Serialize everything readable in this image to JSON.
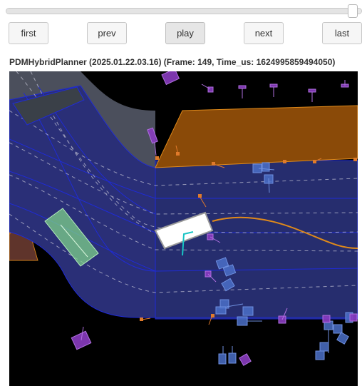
{
  "slider": {
    "position_fraction": 0.99
  },
  "controls": {
    "first_label": "first",
    "prev_label": "prev",
    "play_label": "play",
    "next_label": "next",
    "last_label": "last"
  },
  "header": {
    "title": "PDMHybridPlanner (2025.01.22.03.16) (Frame: 149, Time_us: 1624995859494050)"
  },
  "map": {
    "colors": {
      "background": "#000000",
      "lane": "#2a2f77",
      "lane_edge": "#1f2bd6",
      "intersection": "#4b4f5c",
      "crosswalk": "#3a4048",
      "parking_orange": "#8a4a08",
      "parking_edge": "#e08a1a",
      "ego": "#ffffff",
      "planned_path": "#e08a1a",
      "vehicle_agent": "#4b70c8",
      "pedestrian": "#8a3cc0",
      "static_green": "#7ed28a",
      "stop_marker": "#e07a2a"
    }
  }
}
